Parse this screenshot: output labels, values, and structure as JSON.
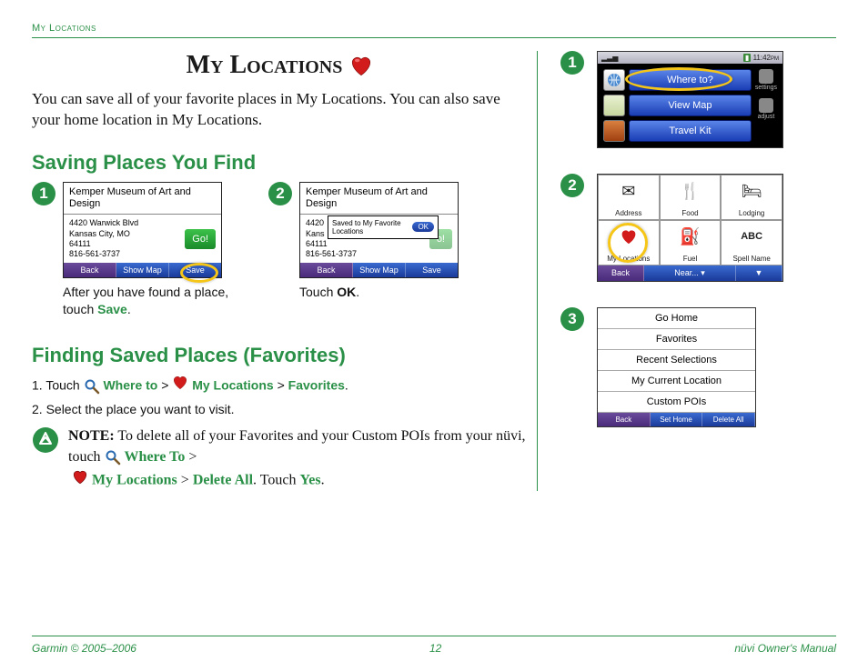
{
  "header": {
    "label": "My Locations"
  },
  "title": "My Locations",
  "intro": "You can save all of your favorite places in My Locations. You can also save your home location in My Locations.",
  "saving": {
    "heading": "Saving Places You Find",
    "step1": {
      "title": "Kemper Museum of Art and Design",
      "addr1": "4420 Warwick Blvd",
      "addr2": "Kansas City, MO",
      "addr3": "64111",
      "addr4": "816-561-3737",
      "go": "Go!",
      "back": "Back",
      "showmap": "Show Map",
      "save": "Save",
      "caption_a": "After you have found a place, touch ",
      "caption_b": "Save",
      "caption_c": "."
    },
    "step2": {
      "popup": "Saved to My Favorite Locations",
      "ok": "OK",
      "caption_a": "Touch ",
      "caption_b": "OK",
      "caption_c": "."
    }
  },
  "finding": {
    "heading": "Finding Saved Places (Favorites)",
    "line1a": "1. Touch ",
    "where": "Where to",
    "gt": " > ",
    "myloc": "My Locations",
    "fav": "Favorites",
    "line1b": ".",
    "line2": "2. Select the place you want to visit.",
    "note_label": "NOTE:",
    "note_a": " To delete all of your Favorites and your Custom POIs from your nüvi, touch ",
    "note_where": "Where To",
    "note_myloc": "My Locations",
    "note_del": "Delete All",
    "note_b": ". Touch ",
    "note_yes": "Yes",
    "note_c": "."
  },
  "right": {
    "r1": {
      "time": "11:42",
      "where": "Where to?",
      "view": "View Map",
      "travel": "Travel Kit",
      "settings": "settings",
      "adjust": "adjust"
    },
    "r2": {
      "address": "Address",
      "food": "Food",
      "lodging": "Lodging",
      "myloc": "My Locations",
      "fuel": "Fuel",
      "spell": "Spell Name",
      "back": "Back",
      "near": "Near..."
    },
    "r3": {
      "items": [
        "Go Home",
        "Favorites",
        "Recent Selections",
        "My Current Location",
        "Custom POIs"
      ],
      "back": "Back",
      "sethome": "Set Home",
      "deleteall": "Delete All"
    }
  },
  "footer": {
    "left": "Garmin © 2005–2006",
    "center": "12",
    "right": "nüvi Owner's Manual"
  }
}
